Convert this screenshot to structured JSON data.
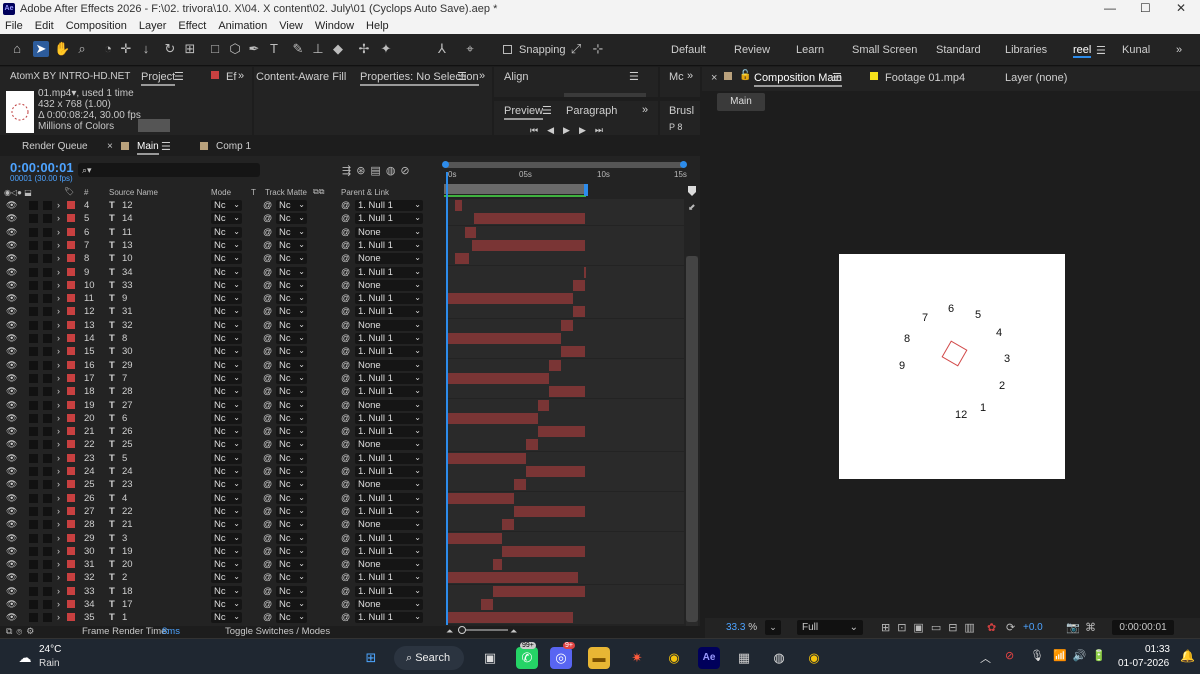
{
  "window": {
    "title": "Adobe After Effects 2026 - F:\\02. trivora\\10. X\\04. X content\\02. July\\01 (Cyclops Auto Save).aep *",
    "app_badge": "Ae",
    "minimize": "—",
    "maximize": "☐",
    "close": "✕"
  },
  "menu": [
    "File",
    "Edit",
    "Composition",
    "Layer",
    "Effect",
    "Animation",
    "View",
    "Window",
    "Help"
  ],
  "toolbar": {
    "snapping": "Snapping"
  },
  "workspaces": [
    "Default",
    "Review",
    "Learn",
    "Small Screen",
    "Standard",
    "Libraries",
    "reel",
    "Kunal"
  ],
  "panels": {
    "atomx": "AtomX BY INTRO-HD.NET",
    "project": "Project",
    "effects": "Ef",
    "content_aware": "Content-Aware Fill",
    "properties": "Properties: No Selection",
    "align": "Align",
    "mc": "Mc",
    "preview": "Preview",
    "paragraph": "Paragraph",
    "brush": "Brusl"
  },
  "project_item": {
    "name": "01.mp4▾",
    "used": ", used 1 time",
    "dims": "432 x 768 (1.00)",
    "duration": "Δ 0:00:08:24, 30.00 fps",
    "colors": "Millions of Colors"
  },
  "timeline_tabs": {
    "render_queue": "Render Queue",
    "main": "Main",
    "comp1": "Comp 1"
  },
  "timecode": {
    "value": "0:00:00:01",
    "frames": "00001 (30.00 fps)"
  },
  "columns": {
    "hash": "#",
    "source": "Source Name",
    "mode": "Mode",
    "t": "T",
    "track_matte": "Track Matte",
    "parent": "Parent & Link"
  },
  "ruler": [
    "0s",
    "05s",
    "10s",
    "15s"
  ],
  "layers": [
    {
      "n": "4",
      "name": "12",
      "mode": "Nc",
      "tm": "Nc",
      "parent": "1. Null 1",
      "bs": 0.03,
      "be": 0.06
    },
    {
      "n": "5",
      "name": "14",
      "mode": "Nc",
      "tm": "Nc",
      "parent": "1. Null 1",
      "bs": 0.11,
      "be": 0.58
    },
    {
      "n": "6",
      "name": "11",
      "mode": "Nc",
      "tm": "Nc",
      "parent": "None",
      "bs": 0.07,
      "be": 0.12
    },
    {
      "n": "7",
      "name": "13",
      "mode": "Nc",
      "tm": "Nc",
      "parent": "1. Null 1",
      "bs": 0.1,
      "be": 0.58
    },
    {
      "n": "8",
      "name": "10",
      "mode": "Nc",
      "tm": "Nc",
      "parent": "None",
      "bs": 0.03,
      "be": 0.09
    },
    {
      "n": "9",
      "name": "34",
      "mode": "Nc",
      "tm": "Nc",
      "parent": "1. Null 1",
      "bs": 0.575,
      "be": 0.58
    },
    {
      "n": "10",
      "name": "33",
      "mode": "Nc",
      "tm": "Nc",
      "parent": "None",
      "bs": 0.53,
      "be": 0.58
    },
    {
      "n": "11",
      "name": "9",
      "mode": "Nc",
      "tm": "Nc",
      "parent": "1. Null 1",
      "bs": 0.0,
      "be": 0.53
    },
    {
      "n": "12",
      "name": "31",
      "mode": "Nc",
      "tm": "Nc",
      "parent": "1. Null 1",
      "bs": 0.53,
      "be": 0.58
    },
    {
      "n": "13",
      "name": "32",
      "mode": "Nc",
      "tm": "Nc",
      "parent": "None",
      "bs": 0.48,
      "be": 0.53
    },
    {
      "n": "14",
      "name": "8",
      "mode": "Nc",
      "tm": "Nc",
      "parent": "1. Null 1",
      "bs": 0.0,
      "be": 0.48
    },
    {
      "n": "15",
      "name": "30",
      "mode": "Nc",
      "tm": "Nc",
      "parent": "1. Null 1",
      "bs": 0.48,
      "be": 0.58
    },
    {
      "n": "16",
      "name": "29",
      "mode": "Nc",
      "tm": "Nc",
      "parent": "None",
      "bs": 0.43,
      "be": 0.48
    },
    {
      "n": "17",
      "name": "7",
      "mode": "Nc",
      "tm": "Nc",
      "parent": "1. Null 1",
      "bs": 0.0,
      "be": 0.43
    },
    {
      "n": "18",
      "name": "28",
      "mode": "Nc",
      "tm": "Nc",
      "parent": "1. Null 1",
      "bs": 0.43,
      "be": 0.58
    },
    {
      "n": "19",
      "name": "27",
      "mode": "Nc",
      "tm": "Nc",
      "parent": "None",
      "bs": 0.38,
      "be": 0.43
    },
    {
      "n": "20",
      "name": "6",
      "mode": "Nc",
      "tm": "Nc",
      "parent": "1. Null 1",
      "bs": 0.0,
      "be": 0.38
    },
    {
      "n": "21",
      "name": "26",
      "mode": "Nc",
      "tm": "Nc",
      "parent": "1. Null 1",
      "bs": 0.38,
      "be": 0.58
    },
    {
      "n": "22",
      "name": "25",
      "mode": "Nc",
      "tm": "Nc",
      "parent": "None",
      "bs": 0.33,
      "be": 0.38
    },
    {
      "n": "23",
      "name": "5",
      "mode": "Nc",
      "tm": "Nc",
      "parent": "1. Null 1",
      "bs": 0.0,
      "be": 0.33
    },
    {
      "n": "24",
      "name": "24",
      "mode": "Nc",
      "tm": "Nc",
      "parent": "1. Null 1",
      "bs": 0.33,
      "be": 0.58
    },
    {
      "n": "25",
      "name": "23",
      "mode": "Nc",
      "tm": "Nc",
      "parent": "None",
      "bs": 0.28,
      "be": 0.33
    },
    {
      "n": "26",
      "name": "4",
      "mode": "Nc",
      "tm": "Nc",
      "parent": "1. Null 1",
      "bs": 0.0,
      "be": 0.28
    },
    {
      "n": "27",
      "name": "22",
      "mode": "Nc",
      "tm": "Nc",
      "parent": "1. Null 1",
      "bs": 0.28,
      "be": 0.58
    },
    {
      "n": "28",
      "name": "21",
      "mode": "Nc",
      "tm": "Nc",
      "parent": "None",
      "bs": 0.23,
      "be": 0.28
    },
    {
      "n": "29",
      "name": "3",
      "mode": "Nc",
      "tm": "Nc",
      "parent": "1. Null 1",
      "bs": 0.0,
      "be": 0.23
    },
    {
      "n": "30",
      "name": "19",
      "mode": "Nc",
      "tm": "Nc",
      "parent": "1. Null 1",
      "bs": 0.23,
      "be": 0.58
    },
    {
      "n": "31",
      "name": "20",
      "mode": "Nc",
      "tm": "Nc",
      "parent": "None",
      "bs": 0.19,
      "be": 0.23
    },
    {
      "n": "32",
      "name": "2",
      "mode": "Nc",
      "tm": "Nc",
      "parent": "1. Null 1",
      "bs": 0.0,
      "be": 0.55
    },
    {
      "n": "33",
      "name": "18",
      "mode": "Nc",
      "tm": "Nc",
      "parent": "1. Null 1",
      "bs": 0.19,
      "be": 0.58
    },
    {
      "n": "34",
      "name": "17",
      "mode": "Nc",
      "tm": "Nc",
      "parent": "None",
      "bs": 0.14,
      "be": 0.19
    },
    {
      "n": "35",
      "name": "1",
      "mode": "Nc",
      "tm": "Nc",
      "parent": "1. Null 1",
      "bs": 0.0,
      "be": 0.53
    }
  ],
  "bottom": {
    "render_label": "Frame Render Time:",
    "render_value": "8ms",
    "toggle": "Toggle Switches / Modes"
  },
  "viewer": {
    "comp_tab": "Composition Main",
    "footage_tab": "Footage 01.mp4",
    "layer_tab": "Layer (none)",
    "breadcrumb": "Main",
    "zoom": "33.3",
    "zoom_unit": "%",
    "quality": "Full",
    "exposure": "+0.0",
    "timecode": "0:00:00:01"
  },
  "comp_numbers": [
    "1",
    "2",
    "3",
    "4",
    "5",
    "6",
    "7",
    "8",
    "9",
    "12"
  ],
  "taskbar": {
    "temp": "24°C",
    "weather": "Rain",
    "search": "Search",
    "whatsapp_badge": "99+",
    "discord_badge": "9+",
    "time": "01:33",
    "date": "01-07-2026"
  },
  "colors": {
    "accent": "#2d8ceb",
    "label_red": "#c84040",
    "bar_red": "#7a3535",
    "timecode_blue": "#4da3ff"
  }
}
